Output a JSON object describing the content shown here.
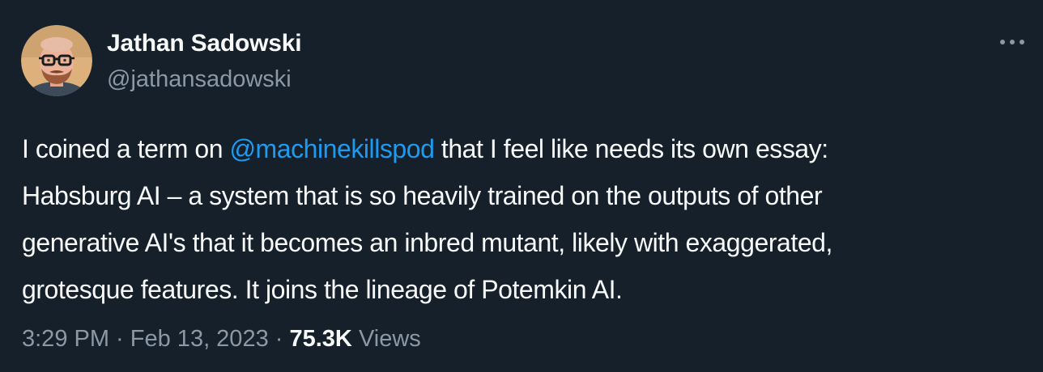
{
  "author": {
    "display_name": "Jathan Sadowski",
    "handle": "@jathansadowski",
    "avatar_icon": "user-avatar-photo"
  },
  "more_icon": "more-horizontal-icon",
  "tweet": {
    "line1_before": "I coined a term on ",
    "mention": "@machinekillspod",
    "line1_after": " that I feel like needs its own essay:",
    "line2": "Habsburg AI – a system that is so heavily trained on the outputs of other",
    "line3": "generative AI's that it becomes an inbred mutant, likely with exaggerated,",
    "line4": "grotesque features. It joins the lineage of Potemkin AI."
  },
  "meta": {
    "time": "3:29 PM",
    "separator": " · ",
    "date": "Feb 13, 2023",
    "views_count": "75.3K",
    "views_label": "Views"
  },
  "colors": {
    "background": "#15202b",
    "text_primary": "#f7f9f9",
    "text_secondary": "#8b98a5",
    "link": "#1d9bf0"
  }
}
